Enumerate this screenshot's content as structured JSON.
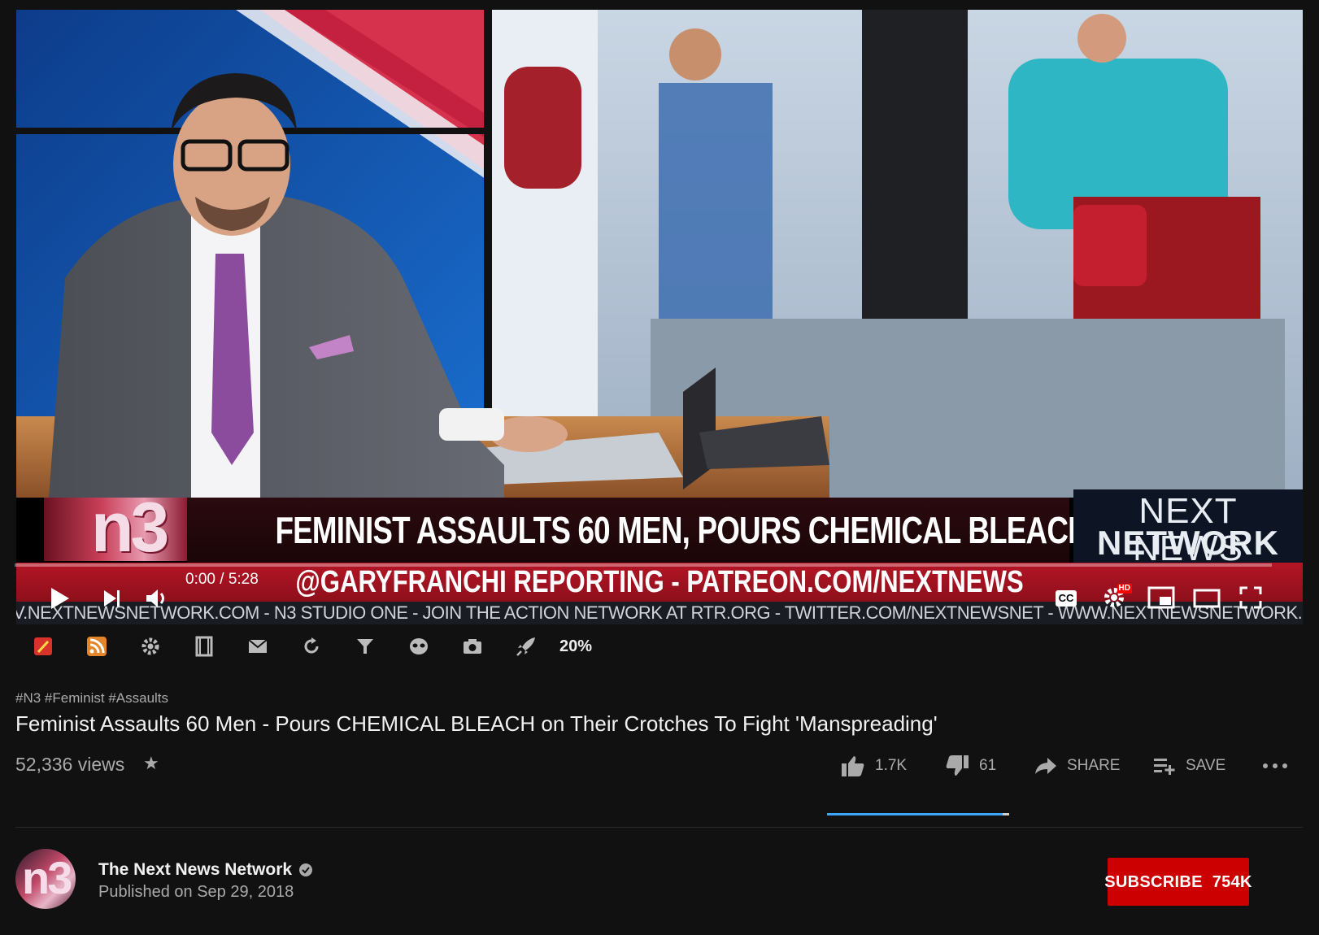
{
  "video": {
    "overlay_headline": "FEMINIST ASSAULTS 60 MEN, POURS CHEMICAL BLEACH ON THEIR CROTCHES",
    "overlay_subline": "@GARYFRANCHI REPORTING - PATREON.COM/NEXTNEWS",
    "overlay_ticker": "V.NEXTNEWSNETWORK.COM - N3 STUDIO ONE - JOIN THE ACTION NETWORK AT RTR.ORG - TWITTER.COM/NEXTNEWSNET - WWW.NEXTNEWSNETWORK.COM - N",
    "overlay_brand_line1": "NEXT NEWS",
    "overlay_brand_line2": "NETWORK",
    "overlay_logo": "n3"
  },
  "player": {
    "time_display": "0:00 / 5:28",
    "progress_fraction": 0.0,
    "hd_badge": "HD",
    "cc_label": "CC",
    "accent_color": "#ff0000"
  },
  "extension_toolbar": {
    "icons": [
      "magic-wand-icon",
      "rss-icon",
      "gear-icon",
      "film-icon",
      "mail-icon",
      "loop-icon",
      "filter-icon",
      "mask-icon",
      "camera-icon",
      "rocket-icon"
    ],
    "percent": "20%"
  },
  "meta": {
    "hashtags": "#N3 #Feminist #Assaults",
    "title": "Feminist Assaults 60 Men - Pours CHEMICAL BLEACH on Their Crotches To Fight 'Manspreading'",
    "views": "52,336 views",
    "star": "★"
  },
  "actions": {
    "likes": "1.7K",
    "dislikes": "61",
    "share_label": "SHARE",
    "save_label": "SAVE",
    "like_fraction": 0.965,
    "sentiment_color": "#3ea6ff"
  },
  "channel": {
    "name": "The Next News Network",
    "avatar_text": "n3",
    "published": "Published on Sep 29, 2018",
    "subscribe_label": "SUBSCRIBE",
    "subscriber_count": "754K",
    "subscribe_color": "#cc0000"
  }
}
